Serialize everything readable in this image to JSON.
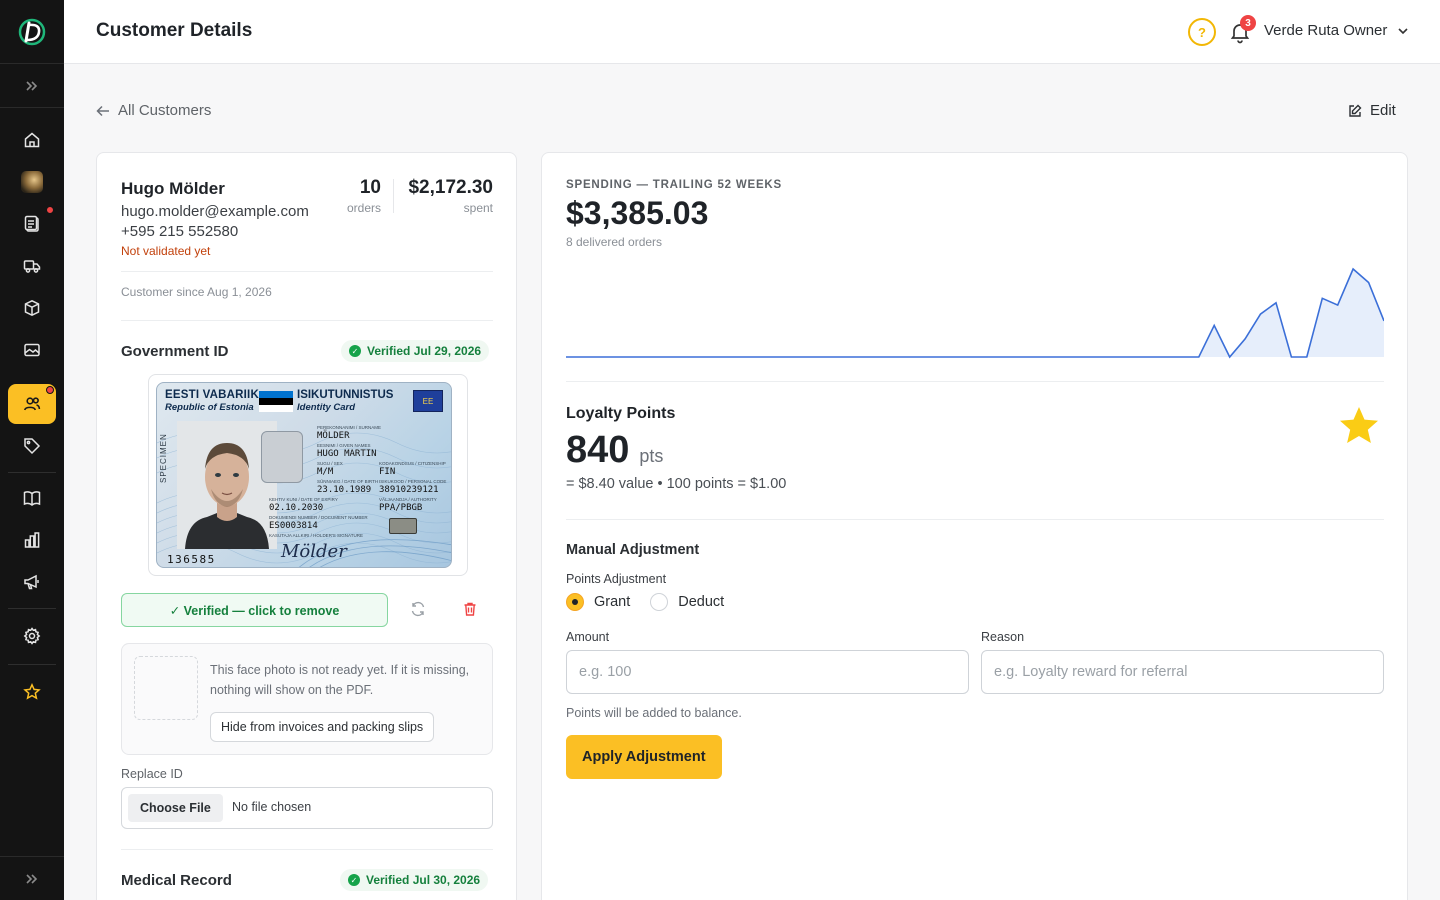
{
  "app": {
    "brand_logo": "brand-d-logo"
  },
  "header": {
    "title": "Customer Details",
    "help_glyph": "?",
    "notification_count": "3",
    "user_label": "Verde Ruta Owner"
  },
  "breadcrumb": {
    "back_label": "All Customers",
    "edit_label": "Edit"
  },
  "sidebar": {
    "items": [
      {
        "name": "home",
        "icon": "home-icon",
        "active": false
      },
      {
        "name": "avatar",
        "icon": "avatar-thumbnail",
        "active": false
      },
      {
        "name": "orders",
        "icon": "clipboard-icon",
        "active": false,
        "dot": true
      },
      {
        "name": "shipping",
        "icon": "truck-icon",
        "active": false
      },
      {
        "name": "products",
        "icon": "box-icon",
        "active": false
      },
      {
        "name": "media",
        "icon": "image-icon",
        "active": false
      },
      {
        "name": "customers",
        "icon": "users-icon",
        "active": true,
        "dot": true
      },
      {
        "name": "tags",
        "icon": "tag-icon",
        "active": false
      },
      {
        "name": "catalog",
        "icon": "book-open-icon",
        "active": false
      },
      {
        "name": "reports",
        "icon": "bar-chart-icon",
        "active": false
      },
      {
        "name": "marketing",
        "icon": "megaphone-icon",
        "active": false
      },
      {
        "name": "settings",
        "icon": "gear-icon",
        "active": false
      },
      {
        "name": "favorites",
        "icon": "star-icon",
        "active": false
      }
    ],
    "accent_color": "#fbbf24"
  },
  "customer": {
    "name": "Hugo Mölder",
    "email": "hugo.molder@example.com",
    "phone": "+595 215 552580",
    "validation_status": "Not validated yet",
    "orders_count": "10",
    "orders_label": "orders",
    "spent": "$2,172.30",
    "spent_label": "spent",
    "since": "Customer since Aug 1, 2026"
  },
  "government_id": {
    "title": "Government ID",
    "verified_label": "Verified Jul 29, 2026",
    "card": {
      "country_et": "EESTI VABARIIK",
      "country_en": "Republic of Estonia",
      "doc_et": "ISIKUTUNNISTUS",
      "doc_en": "Identity Card",
      "eu_code": "EE",
      "specimen": "SPECIMEN",
      "surname_label": "PEREKONNANIMI / SURNAME",
      "surname": "MÖLDER",
      "given_label": "EESNIMI / GIVEN NAMES",
      "given": "HUGO MARTIN",
      "sex_label": "SUGU / SEX",
      "sex": "M/M",
      "citizenship_label": "KODAKONDSUS / CITIZENSHIP",
      "citizenship": "FIN",
      "dob_label": "SÜNNIAEG / DATE OF BIRTH",
      "dob": "23.10.1989",
      "personal_code_label": "ISIKUKOOD / PERSONAL CODE",
      "personal_code": "38910239121",
      "expiry_label": "KEHTIV KUNI / DATE OF EXPIRY",
      "expiry": "02.10.2030",
      "authority_label": "VÄLJAANDJA / AUTHORITY",
      "authority": "PPA/PBGB",
      "doc_number_label": "DOKUMENDI NUMBER / DOCUMENT NUMBER",
      "doc_number": "ES0003814",
      "signature_label": "KASUTAJA ALLKIRI / HOLDER'S SIGNATURE",
      "signature": "Mölder",
      "can_number": "136585"
    },
    "verify_button": "✓ Verified — click to remove"
  },
  "face_photo": {
    "notice": "This face photo is not ready yet. If it is missing, nothing will show on the PDF.",
    "hide_button": "Hide from invoices and packing slips"
  },
  "replace_id": {
    "label": "Replace ID",
    "choose_button": "Choose File",
    "file_status": "No file chosen"
  },
  "medical_record": {
    "title": "Medical Record",
    "verified_label": "Verified Jul 30, 2026"
  },
  "spending": {
    "eyebrow": "SPENDING — TRAILING 52 WEEKS",
    "total": "$3,385.03",
    "delivered": "8 delivered orders"
  },
  "chart_data": {
    "type": "area",
    "title": "",
    "xlabel": "",
    "ylabel": "",
    "x_count": 52,
    "series": [
      {
        "values": [
          0,
          0,
          0,
          0,
          0,
          0,
          0,
          0,
          0,
          0,
          0,
          0,
          0,
          0,
          0,
          0,
          0,
          0,
          0,
          0,
          0,
          0,
          0,
          0,
          0,
          0,
          0,
          0,
          0,
          0,
          0,
          0,
          0,
          0,
          0,
          0,
          0,
          0,
          0,
          0,
          0,
          0,
          28,
          0,
          16,
          38,
          48,
          0,
          0,
          52,
          46,
          78,
          66,
          32
        ]
      }
    ],
    "color": "#3b6fd8",
    "fill": "#e6eefb",
    "grid": false
  },
  "loyalty": {
    "title": "Loyalty Points",
    "points": "840",
    "unit": "pts",
    "value_line": "= $8.40 value  •  100 points = $1.00",
    "star_color": "#facc15"
  },
  "adjustment": {
    "title": "Manual Adjustment",
    "type_label": "Points Adjustment",
    "grant_label": "Grant",
    "deduct_label": "Deduct",
    "selected": "Grant",
    "amount_label": "Amount",
    "amount_placeholder": "e.g. 100",
    "amount_value": "",
    "reason_label": "Reason",
    "reason_placeholder": "e.g. Loyalty reward for referral",
    "reason_value": "",
    "hint": "Points will be added to balance.",
    "apply_button": "Apply Adjustment"
  }
}
